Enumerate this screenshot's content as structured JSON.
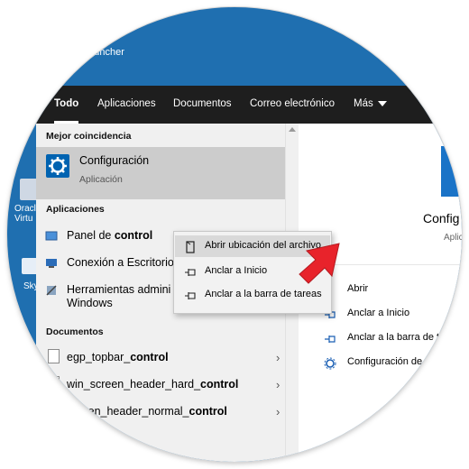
{
  "desktop": {
    "title_fragment": "Launcher",
    "icon1_label": "Oracl\nVirtu",
    "icon2_label": "Sky"
  },
  "tabs": [
    {
      "label": "Todo"
    },
    {
      "label": "Aplicaciones"
    },
    {
      "label": "Documentos"
    },
    {
      "label": "Correo electrónico"
    },
    {
      "label": "Más"
    }
  ],
  "sections": {
    "best_match": "Mejor coincidencia",
    "apps": "Aplicaciones",
    "docs": "Documentos"
  },
  "best_match": {
    "title": "Configuración",
    "subtitle": "Aplicación",
    "icon": "gear-icon"
  },
  "apps": [
    {
      "label": "Panel de control",
      "icon": "control-panel-icon"
    },
    {
      "label": "Conexión a Escritorio",
      "icon": "remote-desktop-icon"
    },
    {
      "label": "Herramientas admini",
      "label2": "Windows",
      "icon": "admin-tools-icon"
    }
  ],
  "docs": [
    {
      "label": "egp_topbar_control",
      "icon": "document-icon"
    },
    {
      "label": "win_screen_header_hard_control",
      "icon": "document-icon"
    },
    {
      "label": "screen_header_normal_control",
      "icon": "document-icon"
    }
  ],
  "context_menu": [
    {
      "label": "Abrir ubicación del archivo",
      "icon": "folder-open-icon",
      "highlighted": true
    },
    {
      "label": "Anclar a Inicio",
      "icon": "pin-icon",
      "highlighted": false
    },
    {
      "label": "Anclar a la barra de tareas",
      "icon": "pin-icon",
      "highlighted": false
    }
  ],
  "preview": {
    "title": "Config",
    "subtitle": "Aplic"
  },
  "actions": [
    {
      "label": "Abrir",
      "icon": "open-icon"
    },
    {
      "label": "Anclar a Inicio",
      "icon": "pin-icon"
    },
    {
      "label": "Anclar a la barra de t",
      "icon": "pin-icon"
    },
    {
      "label": "Configuración de",
      "icon": "gear-icon"
    }
  ],
  "colors": {
    "accent": "#0063b1",
    "tabbar": "#1e1e1e",
    "arrow": "#e8232b"
  }
}
